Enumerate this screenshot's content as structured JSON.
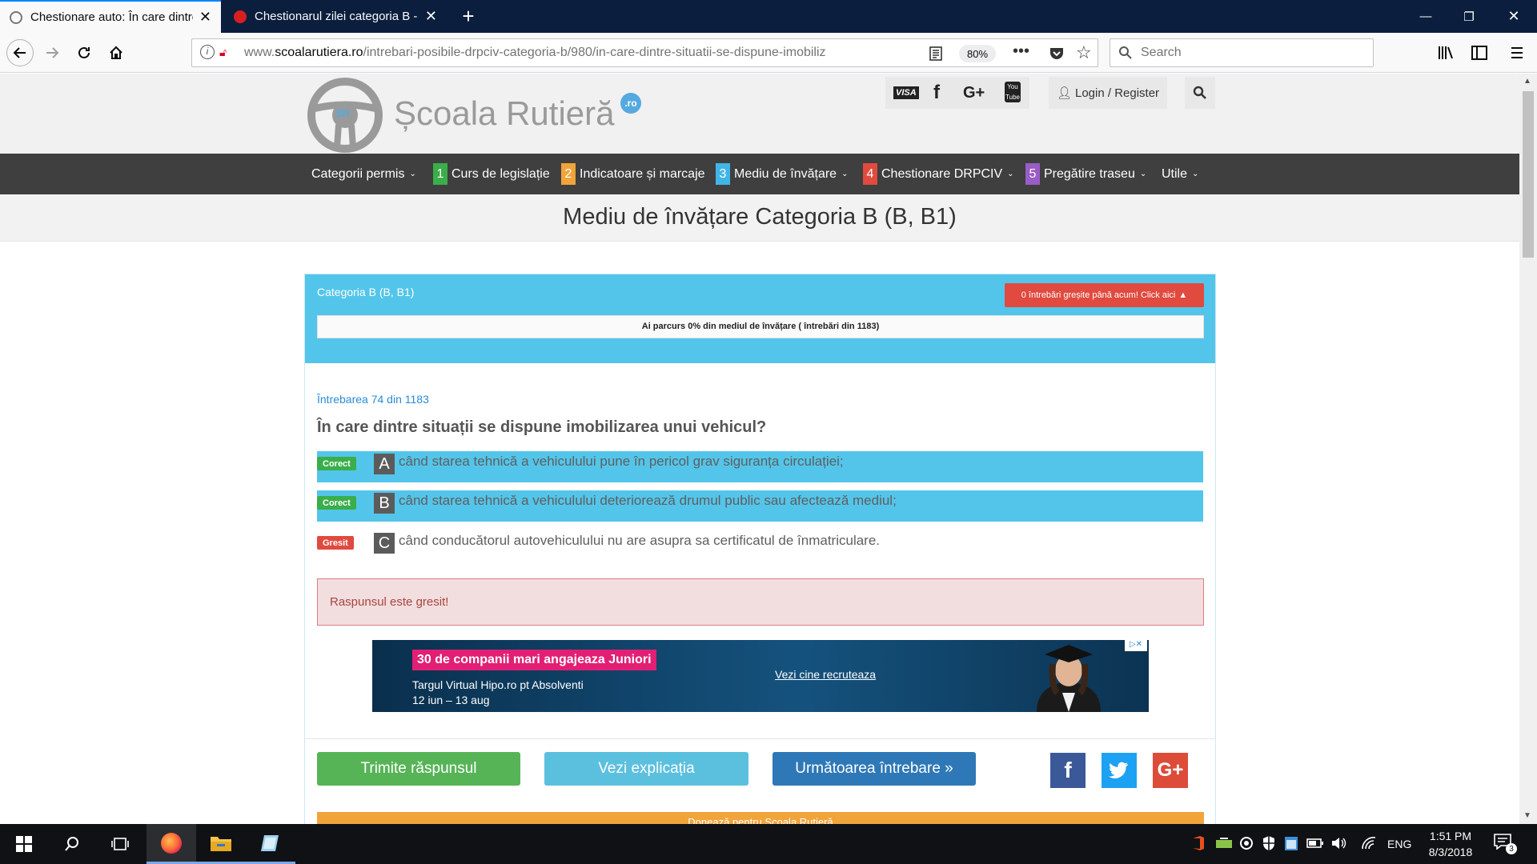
{
  "browser": {
    "tabs": [
      {
        "title": "Chestionare auto: În care dintre"
      },
      {
        "title": "Chestionarul zilei categoria B -"
      }
    ],
    "url_prefix": "www.",
    "url_domain": "scoalarutiera.ro",
    "url_path": "/intrebari-posibile-drpciv-categoria-b/980/in-care-dintre-situatii-se-dispune-imobiliz",
    "zoom": "80%",
    "search_placeholder": "Search",
    "colors": {
      "tabbar": "#0c1e3d",
      "active_tab_line": "#0a84ff"
    }
  },
  "site": {
    "logo": {
      "brand": "Școala Rutieră",
      "badge": "SR",
      "tld": ".ro"
    },
    "header_icons": [
      "visa-icon",
      "facebook-icon",
      "google-plus-icon",
      "youtube-icon"
    ],
    "visa_label": "VISA",
    "login_label": "Login / Register",
    "menu": [
      {
        "label": "Categorii permis",
        "num": "",
        "color": ""
      },
      {
        "label": "Curs de legislație",
        "num": "1",
        "color": "#3aae4a"
      },
      {
        "label": "Indicatoare și marcaje",
        "num": "2",
        "color": "#f0a43a"
      },
      {
        "label": "Mediu de învățare",
        "num": "3",
        "color": "#41b6e6"
      },
      {
        "label": "Chestionare DRPCIV",
        "num": "4",
        "color": "#e04a3f"
      },
      {
        "label": "Pregătire traseu",
        "num": "5",
        "color": "#9a5cc6"
      },
      {
        "label": "Utile",
        "num": "",
        "color": ""
      }
    ],
    "page_title": "Mediu de învățare Categoria B (B, B1)"
  },
  "quiz": {
    "category": "Categoria B (B, B1)",
    "wrong_button": "0 întrebări greșite până acum! Click aici",
    "progress_text": "Ai parcurs 0% din mediul de învățare ( întrebări din 1183)",
    "progress_fraction": 0,
    "question_counter": "Întrebarea 74 din 1183",
    "question": "În care dintre situații se dispune imobilizarea unui vehicul?",
    "answers": [
      {
        "letter": "A",
        "text": "când starea tehnică a vehiculului pune în pericol grav siguranța circulației;",
        "status": "Corect"
      },
      {
        "letter": "B",
        "text": "când starea tehnică a vehiculului deteriorează drumul public sau afectează mediul;",
        "status": "Corect"
      },
      {
        "letter": "C",
        "text": "când conducătorul autovehiculului nu are asupra sa certificatul de înmatriculare.",
        "status": "Gresit"
      }
    ],
    "result_message": "Raspunsul este gresit!",
    "buttons": {
      "submit": "Trimite răspunsul",
      "explain": "Vezi explicația",
      "next": "Următoarea întrebare »"
    },
    "bottom_bar": "Donează pentru Școala Rutieră"
  },
  "ad": {
    "headline": "30 de companii mari angajeaza Juniori",
    "line1": "Targul Virtual Hipo.ro pt Absolventi",
    "line2": "12 iun – 13 aug",
    "cta": "Vezi cine recruteaza"
  },
  "taskbar": {
    "language": "ENG",
    "time": "1:51 PM",
    "date": "8/3/2018",
    "notifications": "3"
  }
}
